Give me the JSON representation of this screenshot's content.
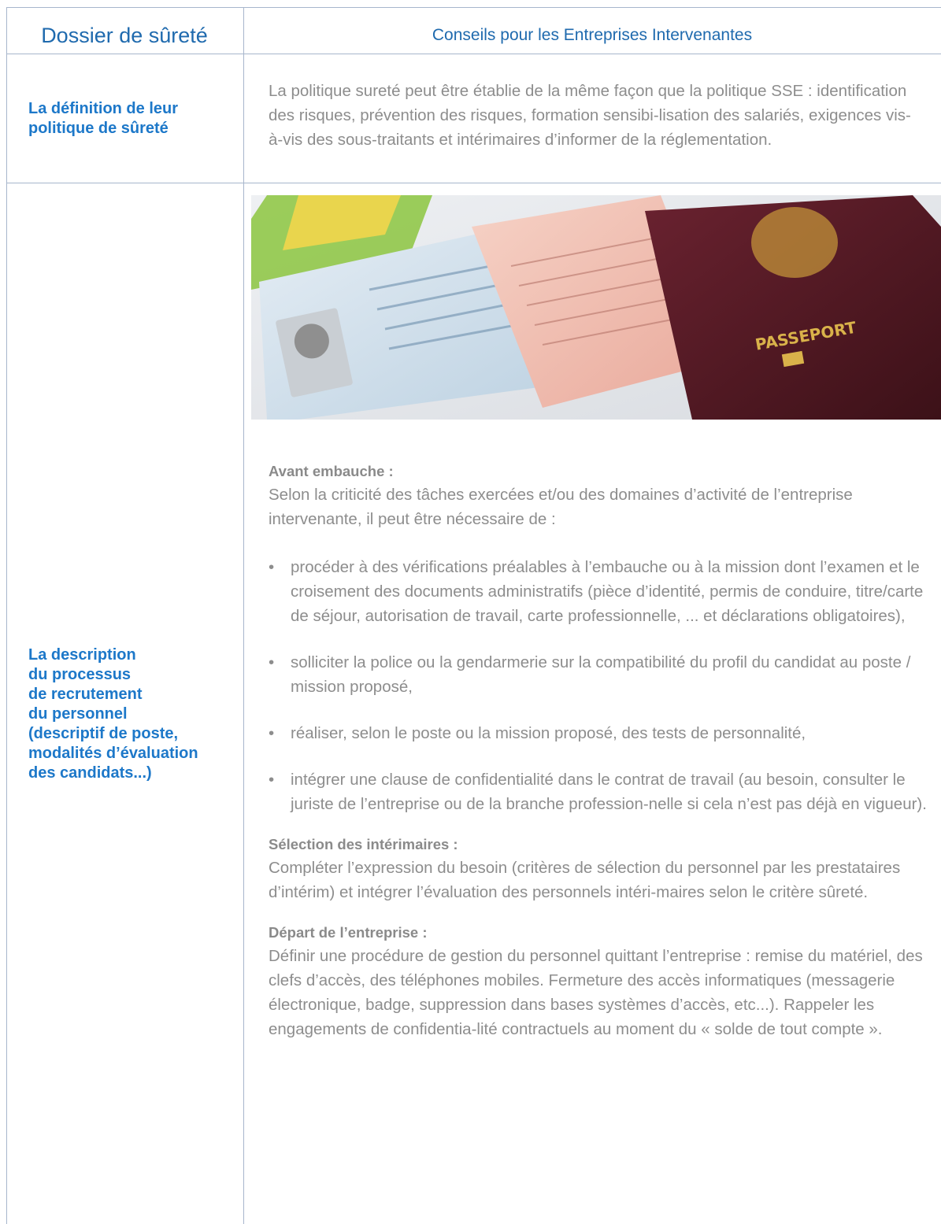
{
  "header": {
    "left_title": "Dossier de sûreté",
    "right_title": "Conseils pour les Entreprises Intervenantes"
  },
  "row1": {
    "label": "La définition de leur politique de sûreté",
    "text": "La politique sureté peut être établie de la même façon que la politique SSE : identification des risques, prévention des risques, formation sensibi-lisation des salariés, exigences vis-à-vis des sous-traitants et intérimaires d’informer de la réglementation."
  },
  "row2": {
    "label_lines": [
      "La description",
      "du processus",
      "de recrutement",
      "du personnel",
      "(descriptif de poste,",
      "modalités d’évaluation",
      "des candidats...)"
    ],
    "photo": {
      "passport_text": "PASSEPORT"
    },
    "section1": {
      "title": "Avant embauche :",
      "intro": "Selon la criticité des tâches exercées et/ou des domaines d’activité de l’entreprise intervenante, il peut être nécessaire de :",
      "bullet_symbol": "•",
      "bullets": [
        "procéder à des vérifications préalables à l’embauche ou à la mission dont l’examen et le croisement des documents administratifs (pièce d’identité, permis de conduire, titre/carte de séjour, autorisation de travail, carte professionnelle, ... et déclarations obligatoires),",
        "solliciter la police ou la gendarmerie sur la compatibilité du profil du candidat au poste / mission proposé,",
        "réaliser, selon le poste ou la mission proposé, des tests de personnalité,",
        "intégrer une clause de confidentialité dans le contrat de travail (au besoin, consulter le juriste de l’entreprise ou de la branche profession-nelle si cela n’est pas déjà en vigueur)."
      ]
    },
    "section2": {
      "title": "Sélection des intérimaires :",
      "text": "Compléter l’expression du besoin (critères de sélection du personnel par les prestataires d’intérim) et intégrer l’évaluation des personnels intéri-maires selon le critère sûreté."
    },
    "section3": {
      "title": "Départ de l’entreprise :",
      "text": "Définir une procédure de gestion du personnel quittant l’entreprise : remise du matériel, des clefs d’accès, des téléphones mobiles. Fermeture des accès informatiques (messagerie électronique, badge, suppression dans bases systèmes d’accès, etc...). Rappeler les engagements de confidentia-lité contractuels au moment du « solde de tout compte »."
    }
  },
  "colors": {
    "border": "#a7b6cc",
    "heading_blue": "#1f6aae",
    "label_blue": "#1d78c9",
    "body_gray": "#8d8d8d"
  }
}
